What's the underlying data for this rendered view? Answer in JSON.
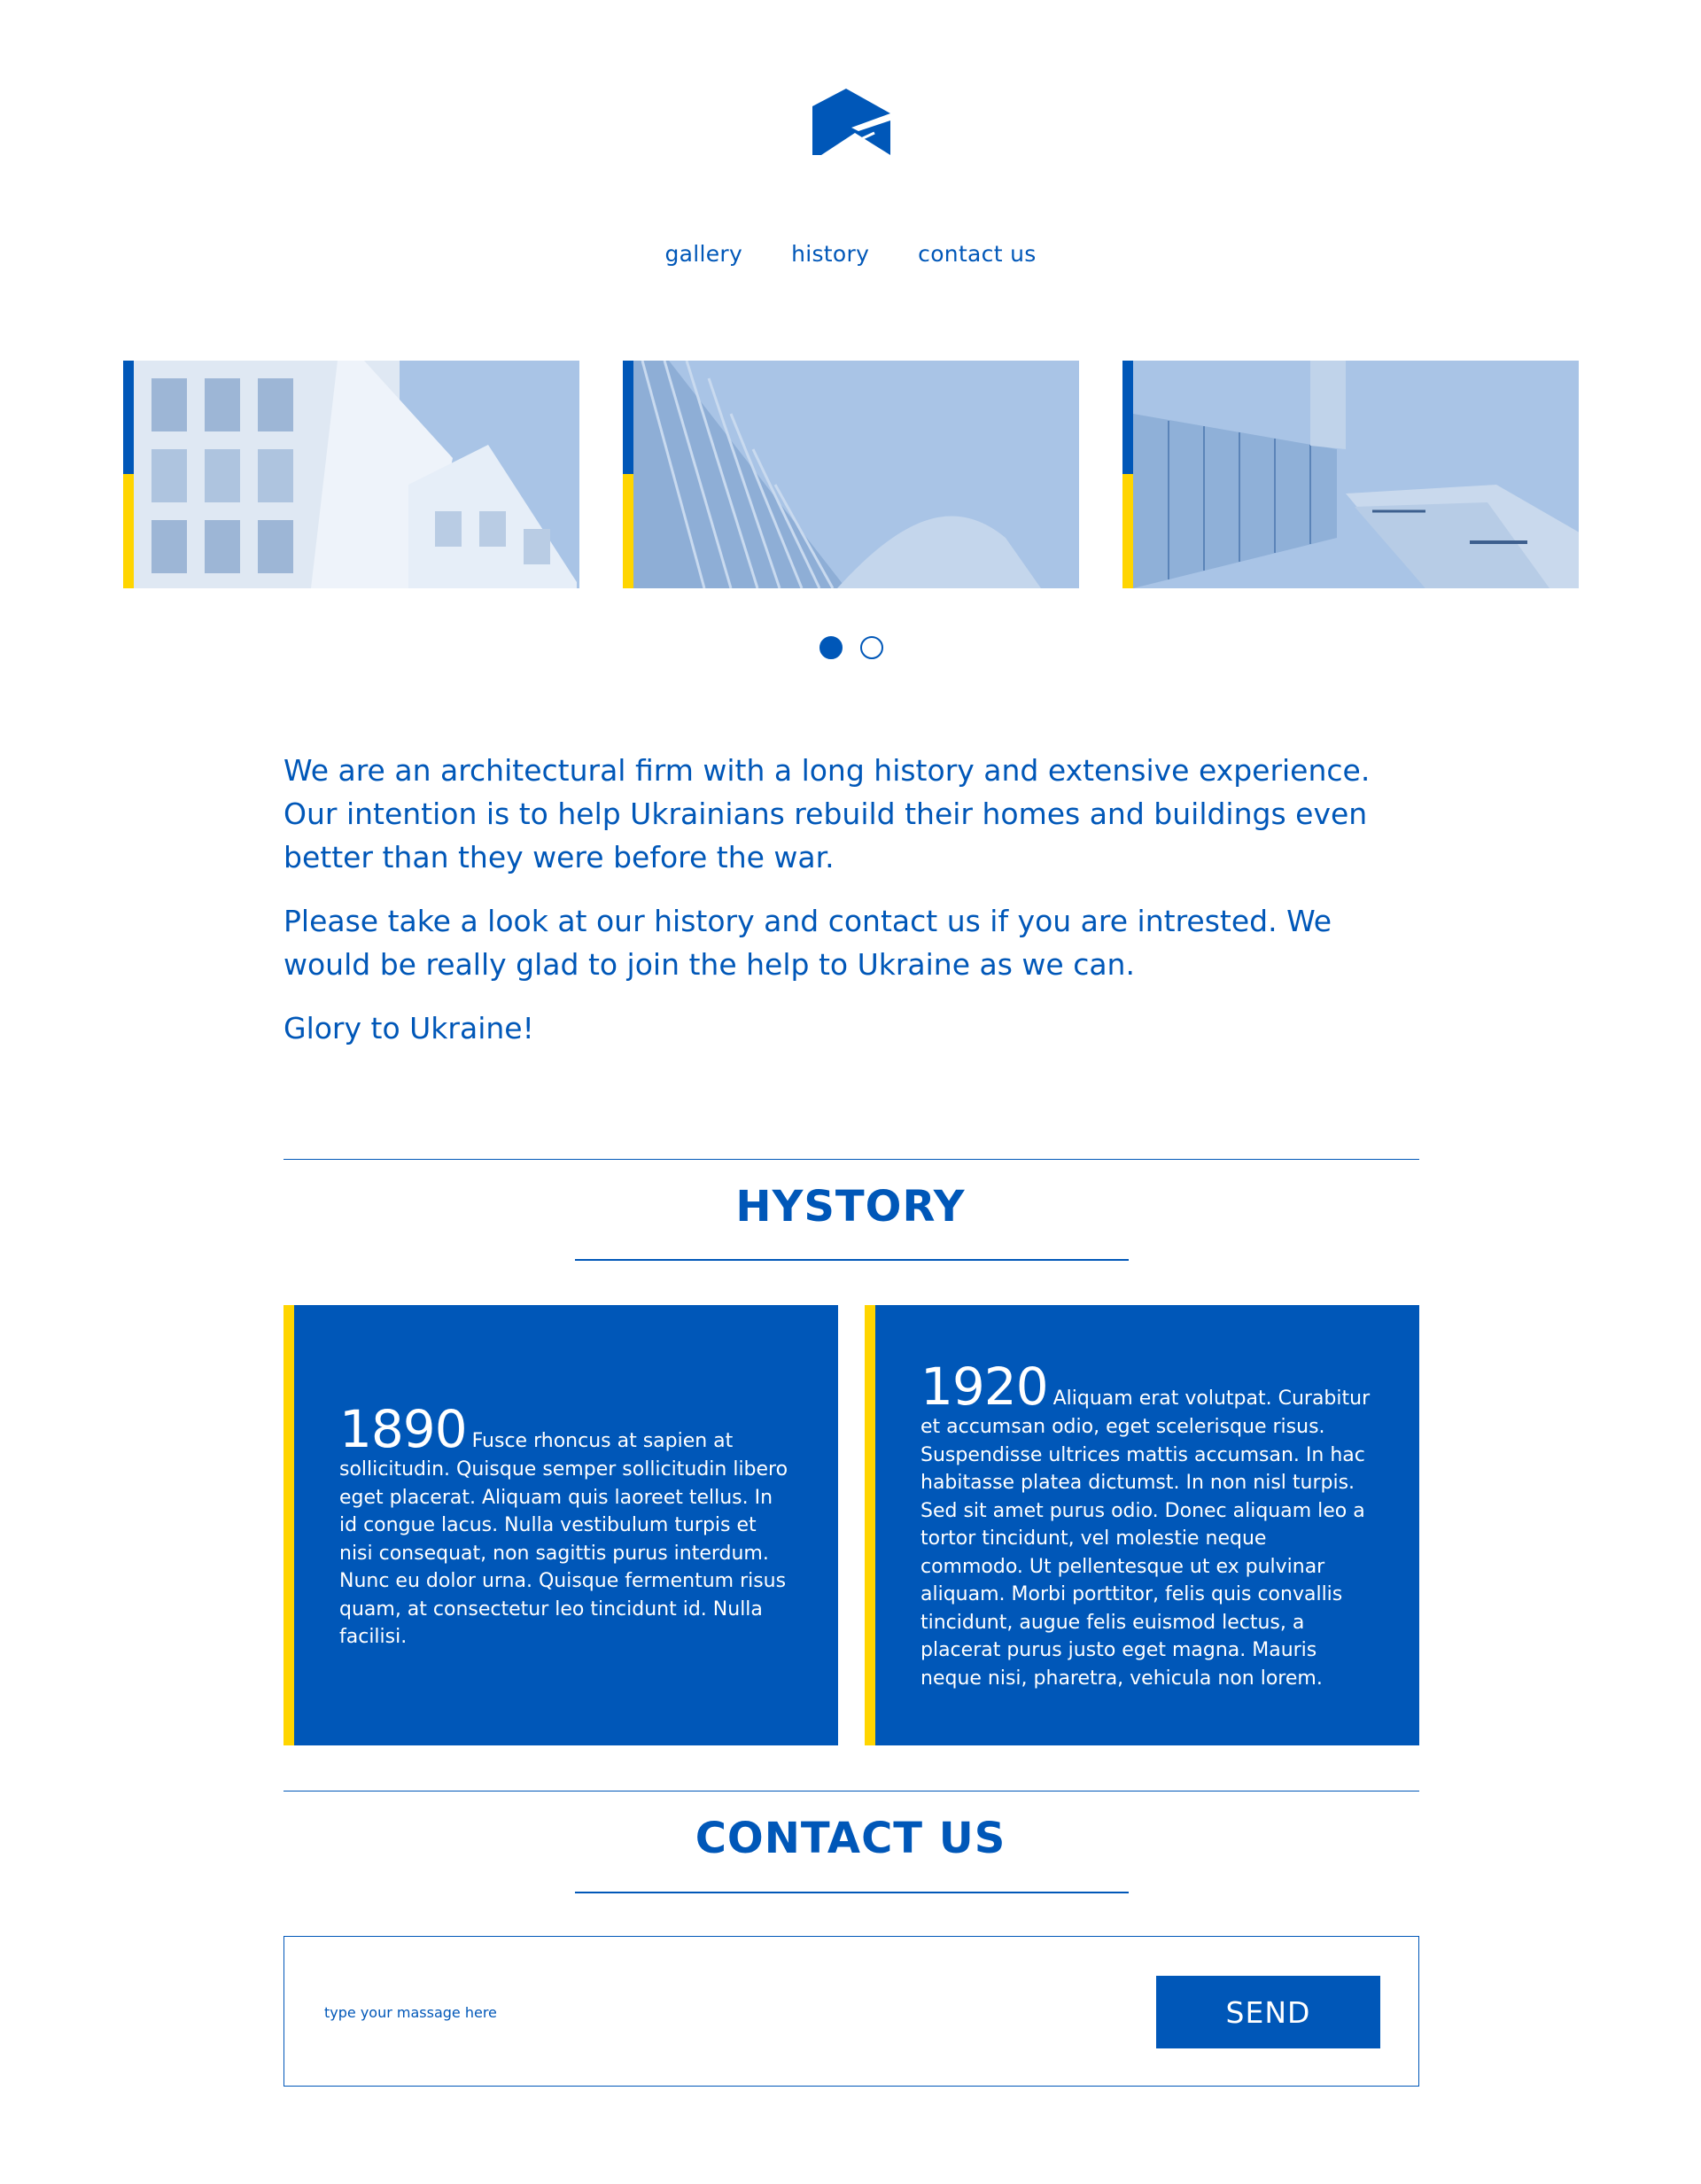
{
  "brand": {
    "logo_icon": "house-roof-logo-icon"
  },
  "colors": {
    "blue": "#0057b8",
    "yellow": "#ffd500",
    "image_tint": "#a9c4e6"
  },
  "nav": {
    "items": [
      {
        "label": "gallery"
      },
      {
        "label": "history"
      },
      {
        "label": "contact us"
      }
    ]
  },
  "gallery": {
    "slides_visible": 3,
    "active_page": 1,
    "pages": 2
  },
  "intro": {
    "paragraphs": [
      "We are an architectural firm with a long history and extensive experience. Our intention is to help Ukrainians rebuild their homes and buildings even better than they were before the war.",
      "Please take a look at our history and contact us if you are intrested. We would be really glad to join the help to Ukraine as we can.",
      "Glory to Ukraine!"
    ]
  },
  "history": {
    "title": "HYSTORY",
    "cards": [
      {
        "year": "1890",
        "text": "Fusce rhoncus at sapien at sollicitudin. Quisque semper sollicitudin libero eget placerat. Aliquam quis laoreet tellus. In id congue lacus. Nulla vestibulum turpis et nisi consequat, non sagittis purus interdum. Nunc eu dolor urna. Quisque fermentum risus quam, at consectetur leo tincidunt id. Nulla facilisi."
      },
      {
        "year": "1920",
        "text": "Aliquam erat volutpat. Curabitur et accumsan odio, eget scelerisque risus. Suspendisse ultrices mattis accumsan. In hac habitasse platea dictumst. In non nisl turpis. Sed sit amet purus odio. Donec aliquam leo a tortor tincidunt, vel molestie neque commodo. Ut pellentesque ut ex pulvinar aliquam. Morbi porttitor, felis quis convallis tincidunt, augue felis euismod lectus, a placerat purus justo eget magna. Mauris neque nisi, pharetra, vehicula non lorem."
      }
    ]
  },
  "contact": {
    "title": "CONTACT US",
    "message_placeholder": "type your massage here",
    "send_label": "SEND"
  }
}
